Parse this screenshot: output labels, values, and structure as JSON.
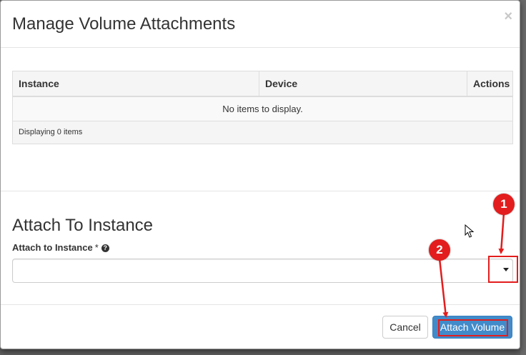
{
  "modal": {
    "title": "Manage Volume Attachments",
    "close_glyph": "×"
  },
  "table": {
    "columns": [
      "Instance",
      "Device",
      "Actions"
    ],
    "empty_message": "No items to display.",
    "footer": "Displaying 0 items"
  },
  "attach": {
    "section_title": "Attach To Instance",
    "field_label": "Attach to Instance",
    "required_marker": "*",
    "help_glyph": "?",
    "selected_value": ""
  },
  "footer": {
    "cancel_label": "Cancel",
    "attach_label": "Attach Volume"
  },
  "annotations": {
    "step_1": "1",
    "step_2": "2",
    "color": "#e31d1d"
  },
  "colors": {
    "primary": "#428bca",
    "highlight": "#e31d1d"
  }
}
